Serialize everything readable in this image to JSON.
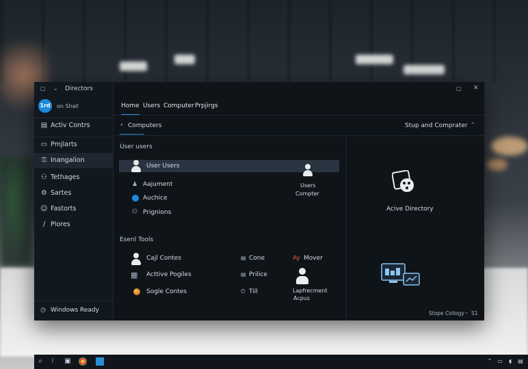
{
  "window": {
    "title": "Directors",
    "account_initials": "1rd",
    "account_label": "on Shall"
  },
  "sidebar": {
    "items": [
      {
        "label": "Activ Contrs",
        "icon": "list-icon"
      },
      {
        "label": "Pmjlarts",
        "icon": "doc-icon"
      },
      {
        "label": "Inangalion",
        "icon": "key-icon"
      },
      {
        "label": "Tethages",
        "icon": "people-icon"
      },
      {
        "label": "Sartes",
        "icon": "gear-icon"
      },
      {
        "label": "Fastorts",
        "icon": "user-icon"
      },
      {
        "label": "Plores",
        "icon": "pen-icon"
      }
    ],
    "status": "Windows Ready"
  },
  "tabs": [
    "Home",
    "Users",
    "Computer",
    "Prpjirgs"
  ],
  "nav": {
    "back_label": "Computers",
    "right_label": "Stup and Comprater"
  },
  "user_users": {
    "heading": "User users",
    "items": [
      "User Users",
      "Aajument",
      "Auchice",
      "Prignions"
    ],
    "tile_line1": "Users",
    "tile_line2": "Compter"
  },
  "right_panel": {
    "ad_label": "Acive Directory"
  },
  "essential_tools": {
    "heading": "Esenl Tools",
    "col1": [
      "Cajl Contes",
      "Acttive Pogiles",
      "Sogle Contes"
    ],
    "col2": [
      "Cone",
      "Prilice",
      "Till"
    ],
    "col3_top": "Mover",
    "col3_top_prefix": "Ay",
    "tile_line1": "Lapfrecment",
    "tile_line2": "Acpus"
  },
  "status_bar": {
    "text": "Stope Collogy",
    "value": "S1"
  },
  "colors": {
    "accent": "#2e8fd9",
    "window_bg": "#0f1419"
  }
}
